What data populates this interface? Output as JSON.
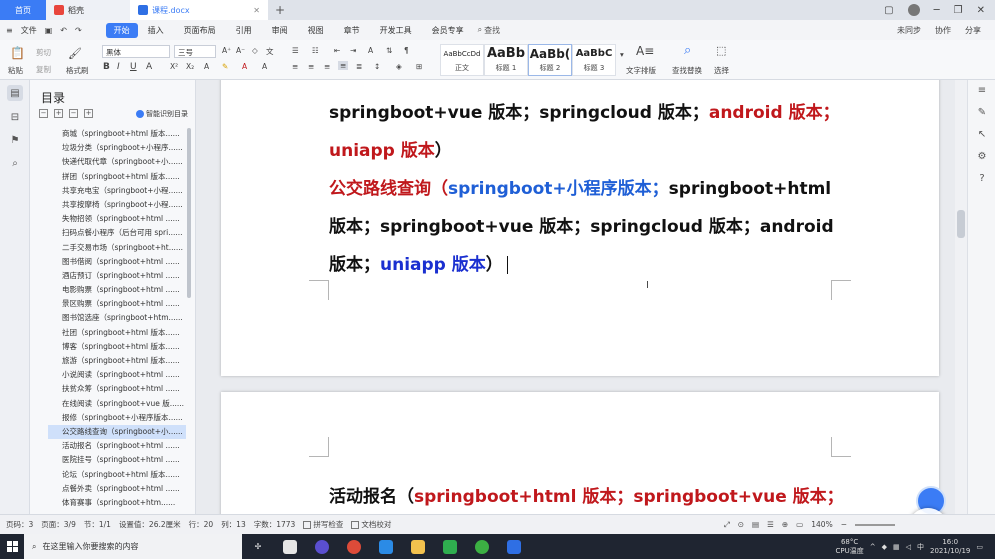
{
  "tabs": {
    "home": "首页",
    "docer": "稻壳",
    "doc": "课程.docx"
  },
  "menu": {
    "file": "文件",
    "items": [
      "开始",
      "插入",
      "页面布局",
      "引用",
      "审阅",
      "视图",
      "章节",
      "开发工具",
      "会员专享"
    ],
    "search": "查找",
    "right": [
      "未同步",
      "协作",
      "分享"
    ]
  },
  "ribbon": {
    "paste": "粘贴",
    "cut": "剪切",
    "copy": "复制",
    "format_painter": "格式刷",
    "font": "黑体",
    "size": "三号",
    "styles": [
      {
        "sample": "AaBbCcDd",
        "label": "正文"
      },
      {
        "sample": "AaBb",
        "label": "标题 1"
      },
      {
        "sample": "AaBb(",
        "label": "标题 2"
      },
      {
        "sample": "AaBbC",
        "label": "标题 3"
      }
    ],
    "text_layout": "文字排版",
    "find_replace": "查找替换",
    "select": "选择"
  },
  "outline": {
    "title": "目录",
    "smart_label": "智能识别目录",
    "items": [
      "商城（springboot+html 版本......",
      "垃圾分类（springboot+小程序......",
      "快递代取代章（springboot+小......",
      "拼团（springboot+html 版本......",
      "共享充电宝（springboot+小程......",
      "共享按摩椅（springboot+小程......",
      "失物招领（springboot+html ......",
      "扫码点餐小程序（后台可用 spri......",
      "二手交易市场（springboot+ht......",
      "图书借阅（springboot+html ......",
      "酒店预订（springboot+html ......",
      "电影购票（springboot+html ......",
      "景区购票（springboot+html ......",
      "图书馆选座（springboot+htm......",
      "社团（springboot+html 版本......",
      "博客（springboot+html 版本......",
      "旅游（springboot+html 版本......",
      "小说阅读（springboot+html ......",
      "扶贫众筹（springboot+html ......",
      "在线阅读（springboot+vue 版......",
      "报修（springboot+小程序版本......",
      "公交路线查询（springboot+小......",
      "活动报名（springboot+html ......",
      "医院挂号（springboot+html ......",
      "论坛（springboot+html 版本......",
      "点餐外卖（springboot+html ......",
      "体育赛事（springboot+htm......"
    ],
    "active_index": 21
  },
  "document": {
    "p1_a": "springboot+vue 版本；springcloud 版本；",
    "p1_b": "android 版本；",
    "p1_c": "uniapp 版本",
    "p1_d": "）",
    "p2_a": "公交路线查询（",
    "p2_b": "springboot+小程序版本；",
    "p2_c": "springboot+html",
    "p2_line2": "版本；springboot+vue 版本；springcloud 版本；android",
    "p2_line3_a": "版本；",
    "p2_line3_b": "uniapp 版本",
    "p2_line3_c": "）",
    "p3_a": "活动报名（",
    "p3_b": "springboot+html 版本；springboot+vue 版本；"
  },
  "status": {
    "page": "页码：3",
    "pages": "页面：3/9",
    "section": "节：1/1",
    "setting": "设置值：26.2厘米",
    "row": "行：20",
    "col": "列：13",
    "words": "字数：1773",
    "spell": "拼写检查",
    "proof": "文档校对",
    "zoom": "140%"
  },
  "taskbar": {
    "search_placeholder": "在这里输入你要搜索的内容",
    "temp": "68°C",
    "temp_label": "CPU温度",
    "time": "16:0",
    "date": "2021/10/19"
  },
  "colors": {
    "accent": "#3b7cf5",
    "red_text": "#c0181c",
    "blue_text": "#1f5fd6",
    "navy_text": "#1a2fd0"
  }
}
